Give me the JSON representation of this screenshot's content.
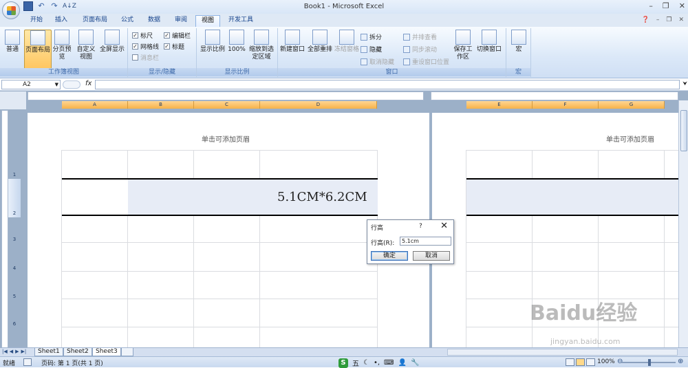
{
  "window": {
    "title": "Book1 - Microsoft Excel"
  },
  "tabs": [
    "开始",
    "插入",
    "页面布局",
    "公式",
    "数据",
    "审阅",
    "视图",
    "开发工具"
  ],
  "active_tab": "视图",
  "ribbon": {
    "workbook_views": {
      "label": "工作簿视图",
      "buttons": [
        "普通",
        "页面布局",
        "分页预览",
        "自定义视图",
        "全屏显示"
      ]
    },
    "show_hide": {
      "label": "显示/隐藏",
      "items": [
        {
          "label": "标尺",
          "checked": "✓"
        },
        {
          "label": "编辑栏",
          "checked": "✓"
        },
        {
          "label": "网格线",
          "checked": "✓"
        },
        {
          "label": "标题",
          "checked": "✓"
        },
        {
          "label": "消息栏",
          "checked": ""
        }
      ]
    },
    "zoom": {
      "label": "显示比例",
      "buttons": [
        "显示比例",
        "100%",
        "缩放到选定区域"
      ]
    },
    "window": {
      "label": "窗口",
      "buttons": [
        "新建窗口",
        "全部重排",
        "冻结窗格",
        "保存工作区",
        "切换窗口"
      ],
      "small": [
        "拆分",
        "隐藏",
        "取消隐藏",
        "并排查看",
        "同步滚动",
        "重设窗口位置"
      ]
    },
    "macro": {
      "label": "宏",
      "button": "宏"
    }
  },
  "formula_bar": {
    "name_box": "A2",
    "fx": "fx",
    "value": ""
  },
  "columns_left": [
    "A",
    "B",
    "C",
    "D"
  ],
  "columns_right": [
    "E",
    "F",
    "G"
  ],
  "rows": [
    "1",
    "2",
    "3",
    "4",
    "5",
    "6"
  ],
  "page": {
    "header_hint": "单击可添加页眉",
    "cell_text": "5.1CM*6.2CM"
  },
  "dialog": {
    "title": "行高",
    "help": "?",
    "close": "✕",
    "label": "行高(R):",
    "value": "5.1cm",
    "ok": "确定",
    "cancel": "取消"
  },
  "sheets": [
    "Sheet1",
    "Sheet2",
    "Sheet3"
  ],
  "active_sheet": "Sheet3",
  "status": {
    "ready": "就绪",
    "page": "页码: 第 1 页(共 1 页)",
    "zoom": "100%",
    "ime_label": "五"
  },
  "watermark": {
    "text": "Baidu经验",
    "sub": "jingyan.baidu.com"
  }
}
